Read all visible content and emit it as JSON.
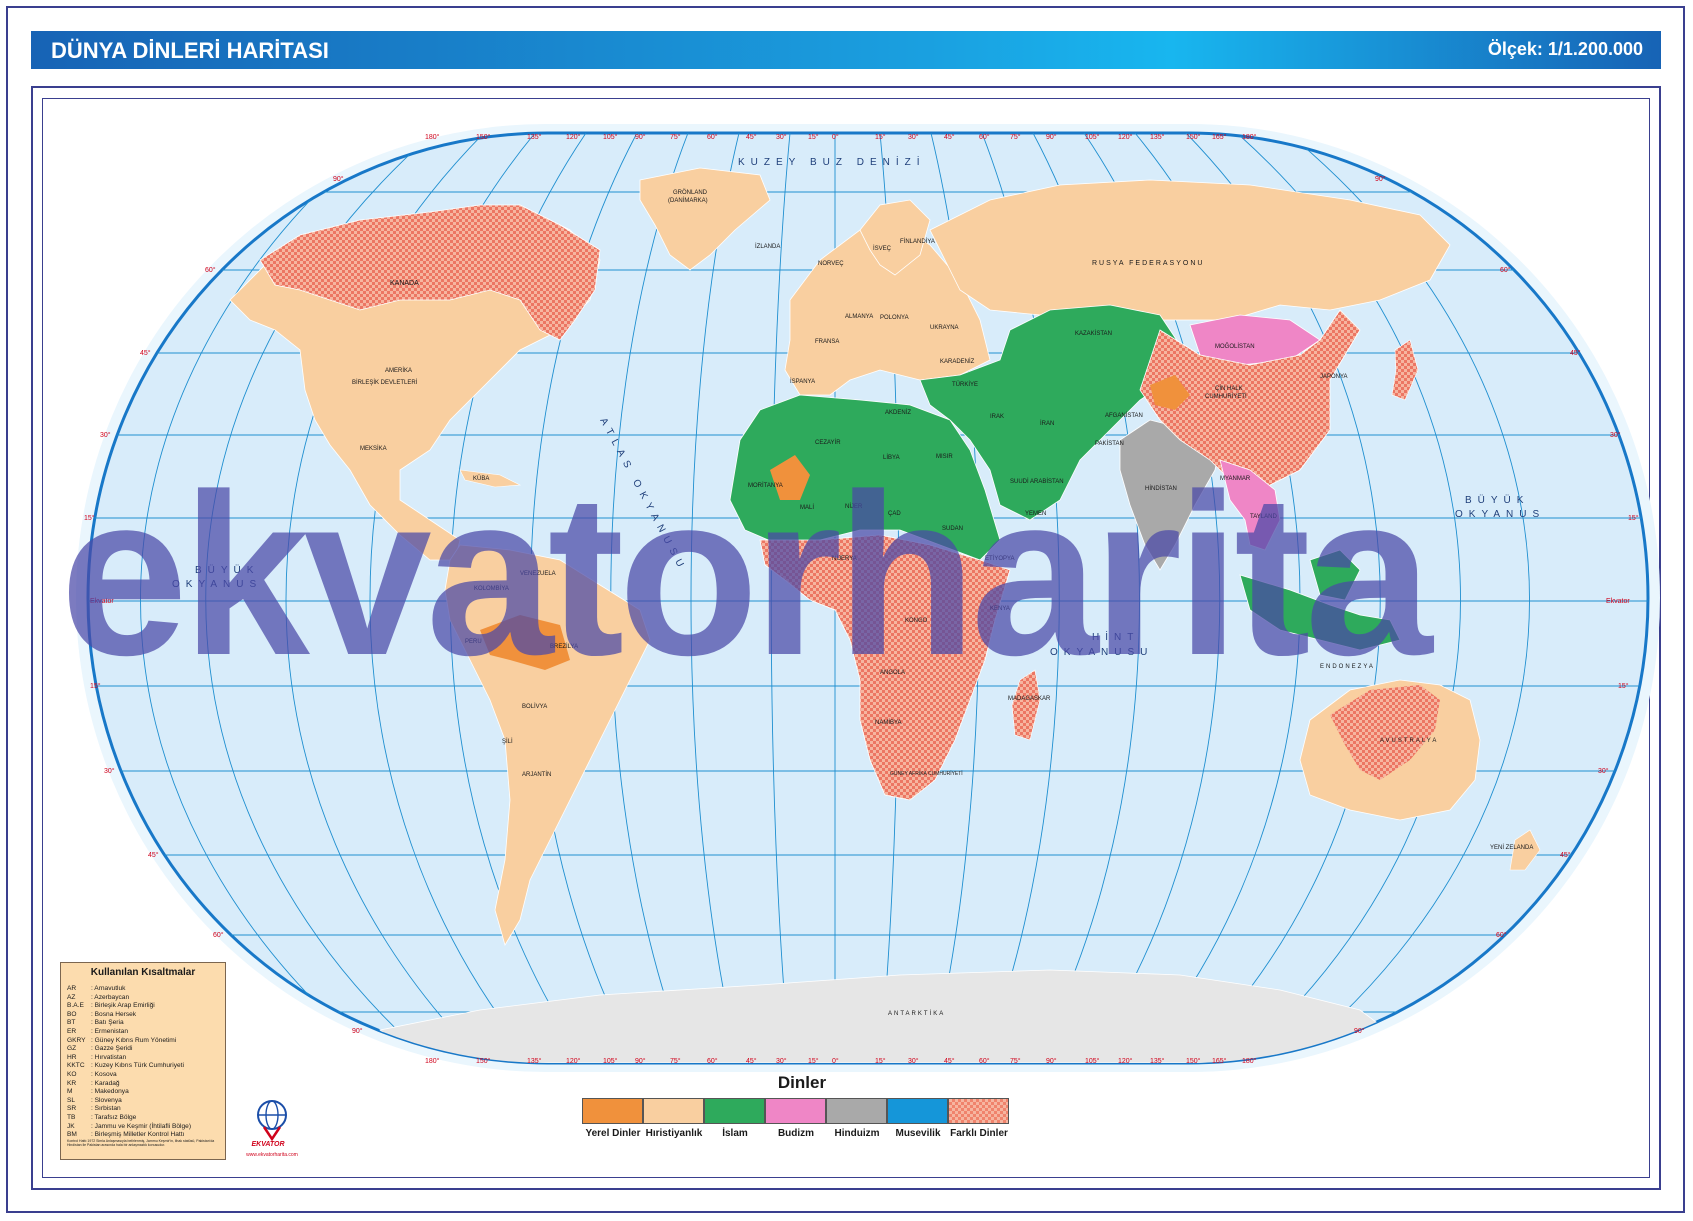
{
  "header": {
    "title": "DÜNYA DİNLERİ HARİTASI",
    "scale": "Ölçek: 1/1.200.000"
  },
  "oceans": {
    "arctic": "KUZEY BUZ DENİZİ",
    "atlantic": "ATLAS OKYANUSU",
    "pacific_west_1": "BÜYÜK",
    "pacific_west_2": "OKYANUS",
    "pacific_east_1": "BÜYÜK",
    "pacific_east_2": "OKYANUS",
    "indian_1": "HİNT",
    "indian_2": "OKYANUSU",
    "mediterranean": "AKDENİZ",
    "black_sea": "KARADENİZ"
  },
  "countries": {
    "greenland": "GRÖNLAND",
    "greenland_sub": "(DANİMARKA)",
    "canada": "KANADA",
    "usa_1": "AMERİKA",
    "usa_2": "BİRLEŞİK DEVLETLERİ",
    "mexico": "MEKSİKA",
    "russia": "RUSYA FEDERASYONU",
    "china_1": "ÇİN HALK",
    "china_2": "CUMHURİYETİ",
    "mongolia": "MOĞOLİSTAN",
    "kazakhstan": "KAZAKİSTAN",
    "brazil": "BREZİLYA",
    "argentina": "ARJANTİN",
    "australia": "AVUSTRALYA",
    "antarctica": "ANTARKTİKA",
    "india": "HİNDİSTAN",
    "iran": "İRAN",
    "turkey": "TÜRKİYE",
    "algeria": "CEZAYİR",
    "libya": "LİBYA",
    "egypt": "MISIR",
    "saudi": "SUUDİ ARABİSTAN",
    "niger": "NİJER",
    "chad": "ÇAD",
    "mali": "MALİ",
    "mauritania": "MORİTANYA",
    "sudan": "SUDAN",
    "congo": "KONGO",
    "angola": "ANGOLA",
    "namibia": "NAMİBYA",
    "south_africa": "GÜNEY AFRİKA CUMHURİYETİ",
    "madagascar": "MADAGASKAR",
    "peru": "PERU",
    "bolivia": "BOLİVYA",
    "colombia": "KOLOMBİYA",
    "venezuela": "VENEZUELA",
    "chile": "ŞİLİ",
    "japan": "JAPONYA",
    "indonesia": "ENDONEZYA",
    "new_zealand": "YENİ ZELANDA",
    "norway": "NORVEÇ",
    "sweden": "İSVEÇ",
    "finland": "FİNLANDİYA",
    "iceland": "İZLANDA",
    "spain": "İSPANYA",
    "france": "FRANSA",
    "germany": "ALMANYA",
    "poland": "POLONYA",
    "ukraine": "UKRAYNA",
    "afghanistan": "AFGANİSTAN",
    "pakistan": "PAKİSTAN",
    "myanmar": "MYANMAR",
    "thailand": "TAYLAND",
    "kenya": "KENYA",
    "ethiopia": "ETİYOPYA",
    "yemen": "YEMEN",
    "iraq": "IRAK",
    "cuba": "KÜBA",
    "nigeria": "NİJERYA"
  },
  "legend": {
    "title": "Dinler",
    "items": [
      {
        "label": "Yerel Dinler",
        "color": "#f0913c"
      },
      {
        "label": "Hıristiyanlık",
        "color": "#f9cfa0"
      },
      {
        "label": "İslam",
        "color": "#2eaa5c"
      },
      {
        "label": "Budizm",
        "color": "#ef86c6"
      },
      {
        "label": "Hinduizm",
        "color": "#a9a9a9"
      },
      {
        "label": "Musevilik",
        "color": "#1596d9"
      },
      {
        "label": "Farklı Dinler",
        "color": "#f0836c"
      }
    ]
  },
  "abbreviations": {
    "title": "Kullanılan Kısaltmalar",
    "items": [
      {
        "code": "AR",
        "name": ": Arnavutluk"
      },
      {
        "code": "AZ",
        "name": ": Azerbaycan"
      },
      {
        "code": "B.A.E",
        "name": ": Birleşik Arap Emirliği"
      },
      {
        "code": "BO",
        "name": ": Bosna Hersek"
      },
      {
        "code": "BT",
        "name": ": Batı Şeria"
      },
      {
        "code": "ER",
        "name": ": Ermenistan"
      },
      {
        "code": "GKRY",
        "name": ": Güney Kıbrıs Rum Yönetimi"
      },
      {
        "code": "GZ",
        "name": ": Gazze Şeridi"
      },
      {
        "code": "HR",
        "name": ": Hırvatistan"
      },
      {
        "code": "KKTC",
        "name": ": Kuzey Kıbrıs Türk Cumhuriyeti"
      },
      {
        "code": "KO",
        "name": ": Kosova"
      },
      {
        "code": "KR",
        "name": ": Karadağ"
      },
      {
        "code": "M",
        "name": ": Makedonya"
      },
      {
        "code": "SL",
        "name": ": Slovenya"
      },
      {
        "code": "SR",
        "name": ": Sırbistan"
      },
      {
        "code": "TB",
        "name": ": Tarafsız Bölge"
      },
      {
        "code": "JK",
        "name": ": Jammu ve Keşmir (İhtilafli Bölge)"
      },
      {
        "code": "BM",
        "name": ": Birleşmiş Milletler Kontrol Hattı"
      }
    ],
    "note": "Kontrol Hattı 1972 Simla Anlaşmasıyla belirlenmiş, Jammu Keşmir'in, ilhak statüsü, Pakistan'da Hindistan ile Pakistan arasında hala bir anlaşmazlık konusudur."
  },
  "logo": {
    "name": "EKVATOR",
    "url": "www.ekvatorharita.com"
  },
  "watermark": "ekvatorharita",
  "degrees": {
    "top": [
      "180°",
      "150°",
      "135°",
      "120°",
      "105°",
      "90°",
      "75°",
      "60°",
      "45°",
      "30°",
      "15°",
      "0°",
      "15°",
      "30°",
      "45°",
      "60°",
      "75°",
      "90°",
      "105°",
      "120°",
      "135°",
      "150°",
      "165°",
      "180°"
    ],
    "left": [
      "90°",
      "60°",
      "45°",
      "30°",
      "15°",
      "Ekvator",
      "15°",
      "30°",
      "45°",
      "60°",
      "90°"
    ],
    "right": [
      "90°",
      "60°",
      "45°",
      "30°",
      "15°",
      "Ekvator",
      "15°",
      "30°",
      "45°",
      "60°",
      "90°"
    ]
  }
}
